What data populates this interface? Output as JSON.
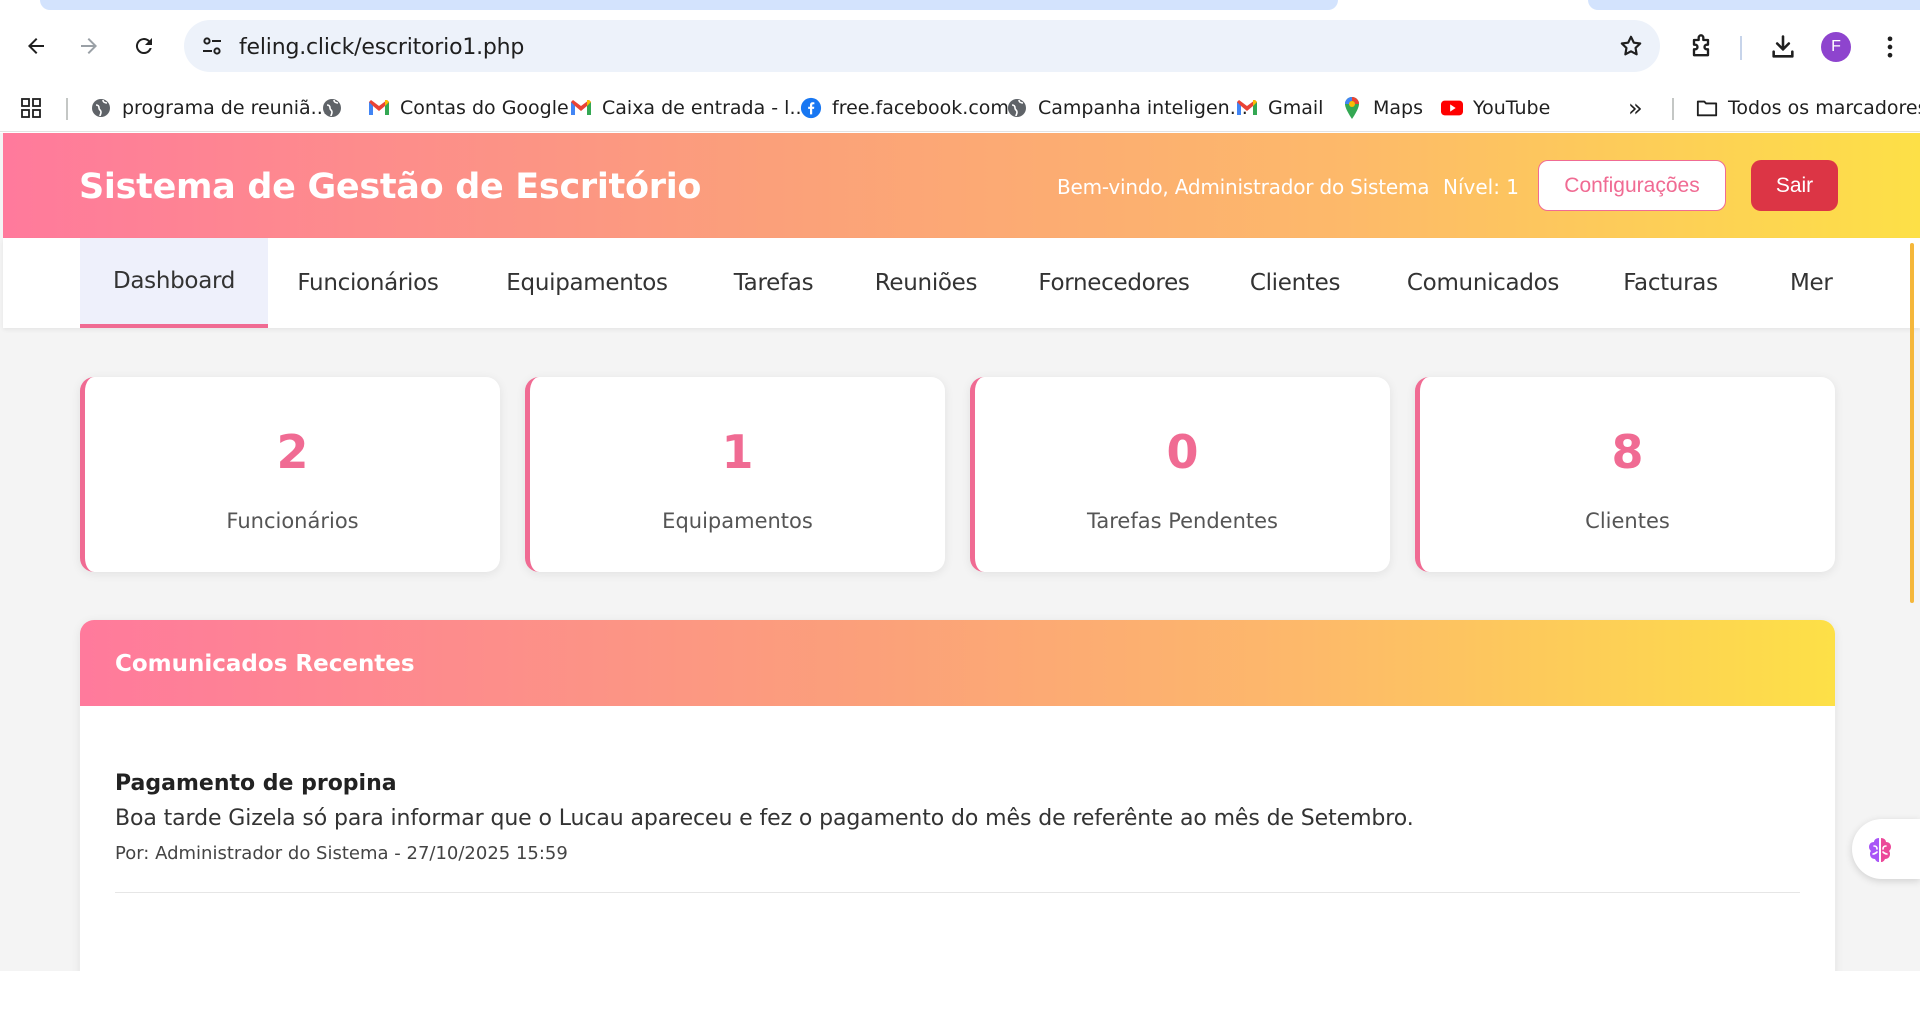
{
  "browser": {
    "url": "feling.click/escritorio1.php",
    "profile_initial": "F",
    "bookmarks": [
      {
        "label": "programa de reuniã...",
        "icon": "globe-icon"
      },
      {
        "label": "",
        "icon": "globe-icon"
      },
      {
        "label": "Contas do Google",
        "icon": "gmail-icon"
      },
      {
        "label": "Caixa de entrada - l...",
        "icon": "gmail-icon"
      },
      {
        "label": "free.facebook.com",
        "icon": "facebook-icon"
      },
      {
        "label": "Campanha inteligen...",
        "icon": "globe-icon"
      },
      {
        "label": "Gmail",
        "icon": "gmail-icon"
      },
      {
        "label": "Maps",
        "icon": "maps-icon"
      },
      {
        "label": "YouTube",
        "icon": "youtube-icon"
      }
    ],
    "more_bookmarks_glyph": "»",
    "all_bookmarks_label": "Todos os marcadores"
  },
  "header": {
    "title": "Sistema de Gestão de Escritório",
    "welcome": "Bem-vindo, Administrador do Sistema",
    "level": "Nível: 1",
    "config_label": "Configurações",
    "exit_label": "Sair"
  },
  "nav": {
    "items": [
      {
        "label": "Dashboard",
        "active": true
      },
      {
        "label": "Funcionários"
      },
      {
        "label": "Equipamentos"
      },
      {
        "label": "Tarefas"
      },
      {
        "label": "Reuniões"
      },
      {
        "label": "Fornecedores"
      },
      {
        "label": "Clientes"
      },
      {
        "label": "Comunicados"
      },
      {
        "label": "Facturas"
      },
      {
        "label": "Mer"
      }
    ]
  },
  "stats": [
    {
      "value": "2",
      "label": "Funcionários"
    },
    {
      "value": "1",
      "label": "Equipamentos"
    },
    {
      "value": "0",
      "label": "Tarefas Pendentes"
    },
    {
      "value": "8",
      "label": "Clientes"
    }
  ],
  "announcements": {
    "title": "Comunicados Recentes",
    "items": [
      {
        "title": "Pagamento de propina",
        "body": "Boa tarde Gizela só para informar que o Lucau apareceu e fez o pagamento do mês de referênte ao mês de Setembro.",
        "meta": "Por: Administrador do Sistema - 27/10/2025 15:59"
      }
    ]
  },
  "colors": {
    "accent": "#f06b93",
    "danger": "#dc3545",
    "gradient_start": "#ff7a9c",
    "gradient_end": "#fde047"
  }
}
